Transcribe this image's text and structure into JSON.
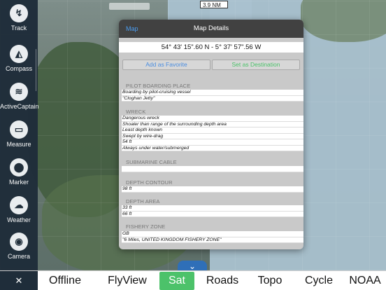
{
  "map": {
    "scale_label": "3.9 NM"
  },
  "sidebar": {
    "items": [
      {
        "label": "Track",
        "glyph": "↯"
      },
      {
        "label": "Compass",
        "glyph": "◭"
      },
      {
        "label": "ActiveCaptain",
        "glyph": "≋"
      },
      {
        "label": "Measure",
        "glyph": "▭"
      },
      {
        "label": "Marker",
        "glyph": "⬤"
      },
      {
        "label": "Weather",
        "glyph": "☁"
      },
      {
        "label": "Camera",
        "glyph": "◉"
      }
    ],
    "corner_glyph": "✕"
  },
  "panel": {
    "back_label": "Map",
    "title": "Map Details",
    "coordinates": "54° 43' 15\".60 N  -  5° 37' 57\".56 W",
    "add_favorite": "Add as Favorite",
    "set_destination": "Set as Destination",
    "sections": [
      {
        "title": "PILOT BOARDING PLACE",
        "rows": [
          "Boarding by pilot-cruising vessel",
          "\"Cloghan Jetty\""
        ]
      },
      {
        "title": "WRECK",
        "rows": [
          "Dangerous wreck",
          "Shoaler than range of the surrounding depth area",
          "Least depth known",
          "Swept by wire-drag",
          " 54 ft",
          "Always under water/submerged"
        ]
      },
      {
        "title": "SUBMARINE CABLE",
        "rows": [
          ""
        ]
      },
      {
        "title": "DEPTH CONTOUR",
        "rows": [
          "98 ft"
        ]
      },
      {
        "title": "DEPTH AREA",
        "rows": [
          "33 ft",
          "66 ft"
        ]
      },
      {
        "title": "FISHERY ZONE",
        "rows": [
          "GB",
          "\"6 Miles, UNITED KINGDOM FISHERY ZONE\""
        ]
      }
    ]
  },
  "tabs": [
    {
      "label": "Offline",
      "selected": false
    },
    {
      "label": "FlyView",
      "selected": false
    },
    {
      "label": "Sat",
      "selected": true
    },
    {
      "label": "Roads",
      "selected": false
    },
    {
      "label": "Topo",
      "selected": false
    },
    {
      "label": "Cycle",
      "selected": false
    },
    {
      "label": "NOAA",
      "selected": false
    }
  ],
  "colors": {
    "accent_blue": "#4a9cf0",
    "accent_green": "#4cc26a",
    "sidebar_bg": "#1f2d3a"
  }
}
